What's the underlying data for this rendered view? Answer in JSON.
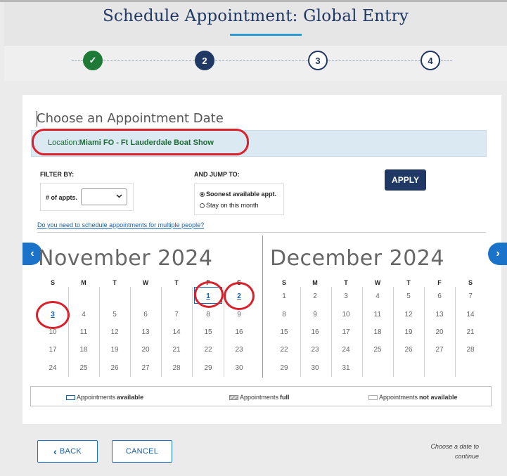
{
  "header": {
    "title": "Schedule Appointment: Global Entry"
  },
  "stepper": {
    "steps": [
      {
        "label": "✓",
        "state": "done"
      },
      {
        "label": "2",
        "state": "current"
      },
      {
        "label": "3",
        "state": "future"
      },
      {
        "label": "4",
        "state": "future"
      }
    ]
  },
  "page": {
    "subtitle": "Choose an Appointment Date"
  },
  "location": {
    "prefix": "Location:",
    "name": "Miami FO - Ft Lauderdale Boat Show"
  },
  "filter": {
    "heading": "FILTER BY:",
    "appts_label": "# of appts.",
    "appts_value": ""
  },
  "jump": {
    "heading": "AND JUMP TO:",
    "options": [
      {
        "label": "Soonest available appt.",
        "selected": true
      },
      {
        "label": "Stay on this month",
        "selected": false
      }
    ]
  },
  "apply_label": "APPLY",
  "multi_link": "Do you need to schedule appointments for multiple people?",
  "nav": {
    "prev": "‹",
    "next": "›"
  },
  "calendar": {
    "weekdays": [
      "S",
      "M",
      "T",
      "W",
      "T",
      "F",
      "S"
    ],
    "months": [
      {
        "title": "November 2024",
        "weeks": [
          [
            "",
            "",
            "",
            "",
            "",
            "1",
            "2"
          ],
          [
            "3",
            "4",
            "5",
            "6",
            "7",
            "8",
            "9"
          ],
          [
            "10",
            "11",
            "12",
            "13",
            "14",
            "15",
            "16"
          ],
          [
            "17",
            "18",
            "19",
            "20",
            "21",
            "22",
            "23"
          ],
          [
            "24",
            "25",
            "26",
            "27",
            "28",
            "29",
            "30"
          ]
        ],
        "available": [
          "1",
          "2",
          "3"
        ]
      },
      {
        "title": "December 2024",
        "weeks": [
          [
            "1",
            "2",
            "3",
            "4",
            "5",
            "6",
            "7"
          ],
          [
            "8",
            "9",
            "10",
            "11",
            "12",
            "13",
            "14"
          ],
          [
            "15",
            "16",
            "17",
            "18",
            "19",
            "20",
            "21"
          ],
          [
            "22",
            "23",
            "24",
            "25",
            "26",
            "27",
            "28"
          ],
          [
            "29",
            "30",
            "31",
            "",
            "",
            "",
            ""
          ]
        ],
        "available": []
      }
    ]
  },
  "legend": {
    "available": {
      "text": "Appointments ",
      "bold": "available"
    },
    "full": {
      "text": "Appointments ",
      "bold": "full"
    },
    "not_available": {
      "text": "Appointments ",
      "bold": "not available"
    }
  },
  "buttons": {
    "back": "BACK",
    "back_icon": "‹",
    "cancel": "CANCEL"
  },
  "footer_note": {
    "line1": "Choose a date to",
    "line2": "continue"
  },
  "colors": {
    "navy": "#1f3864",
    "accent": "#2b9bd6",
    "done": "#1e7a36",
    "highlight": "#d9202b",
    "link": "#1a5fa8"
  }
}
